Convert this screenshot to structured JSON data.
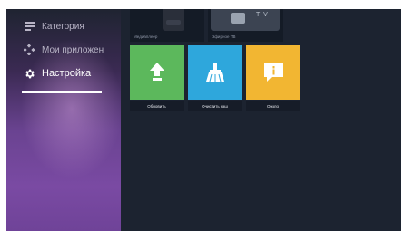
{
  "sidebar": {
    "items": [
      {
        "label": "Категория",
        "icon": "list-icon"
      },
      {
        "label": "Мои приложен",
        "icon": "apps-icon"
      },
      {
        "label": "Настройка",
        "icon": "gear-icon"
      }
    ]
  },
  "top_row": [
    {
      "label": "Медиаплеер"
    },
    {
      "label": "Эфирное ТВ",
      "thumb_text": "T V"
    }
  ],
  "settings_tiles": [
    {
      "label": "Обновить",
      "icon": "upload-arrow-icon",
      "color": "#5cb85c"
    },
    {
      "label": "Очистить кэш",
      "icon": "broom-icon",
      "color": "#2ea7dc"
    },
    {
      "label": "Около",
      "icon": "info-icon",
      "color": "#f2b632"
    }
  ],
  "colors": {
    "main_bg": "#1c2330",
    "sidebar_top": "#1f2431",
    "sidebar_bottom": "#6f4398"
  }
}
